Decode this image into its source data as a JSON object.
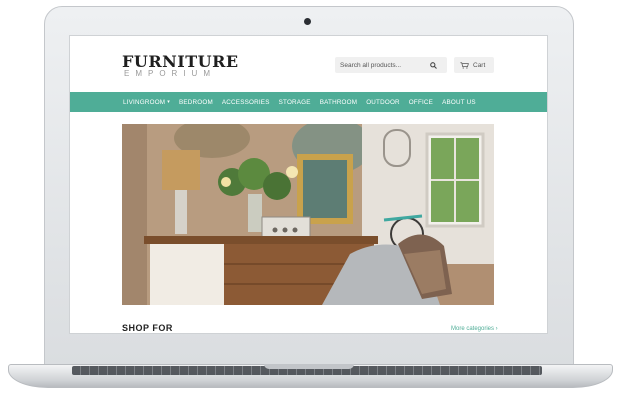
{
  "site": {
    "logo_title": "FURNITURE",
    "logo_subtitle": "EMPORIUM"
  },
  "search": {
    "placeholder": "Search all products..."
  },
  "cart": {
    "label": "Cart"
  },
  "nav": {
    "items": [
      "LIVINGROOM",
      "BEDROOM",
      "ACCESSORIES",
      "STORAGE",
      "BATHROOM",
      "OUTDOOR",
      "OFFICE",
      "ABOUT US"
    ],
    "dropdown_item": "LIVINGROOM"
  },
  "section": {
    "title": "SHOP FOR",
    "more_link": "More categories ›"
  },
  "colors": {
    "accent": "#4fad97",
    "text_dark": "#1f1f1f"
  },
  "icons": [
    "search-icon",
    "cart-icon",
    "chevron-down-icon"
  ]
}
